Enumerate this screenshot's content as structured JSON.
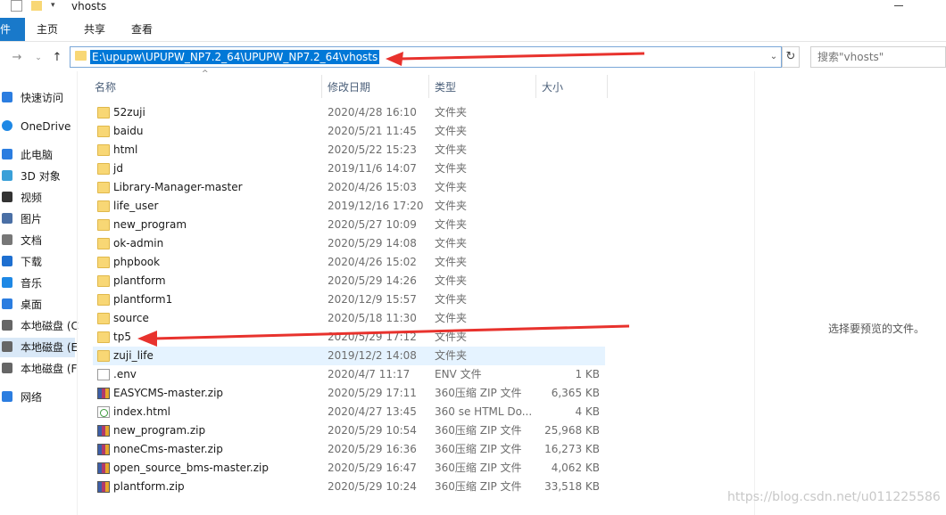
{
  "window": {
    "title": "vhosts",
    "minimize_icon": "minimize-icon"
  },
  "ribbon": {
    "file_tab": "件",
    "tabs": [
      "主页",
      "共享",
      "查看"
    ]
  },
  "address": {
    "path": "E:\\upupw\\UPUPW_NP7.2_64\\UPUPW_NP7.2_64\\vhosts",
    "search_placeholder": "搜索\"vhosts\""
  },
  "sidebar": {
    "items": [
      {
        "label": "快速访问",
        "icon": "star-icon"
      },
      {
        "label": "OneDrive",
        "icon": "cloud-icon"
      },
      {
        "label": "此电脑",
        "icon": "computer-icon"
      },
      {
        "label": "3D 对象",
        "icon": "cube-icon"
      },
      {
        "label": "视频",
        "icon": "video-icon"
      },
      {
        "label": "图片",
        "icon": "picture-icon"
      },
      {
        "label": "文档",
        "icon": "document-icon"
      },
      {
        "label": "下载",
        "icon": "download-icon"
      },
      {
        "label": "音乐",
        "icon": "music-icon"
      },
      {
        "label": "桌面",
        "icon": "desktop-icon"
      },
      {
        "label": "本地磁盘 (C",
        "icon": "drive-icon"
      },
      {
        "label": "本地磁盘 (E",
        "icon": "drive-icon"
      },
      {
        "label": "本地磁盘 (F",
        "icon": "drive-icon"
      },
      {
        "label": "网络",
        "icon": "network-icon"
      }
    ]
  },
  "columns": {
    "name": "名称",
    "date": "修改日期",
    "type": "类型",
    "size": "大小"
  },
  "files": [
    {
      "name": "52zuji",
      "date": "2020/4/28 16:10",
      "type": "文件夹",
      "size": "",
      "kind": "folder"
    },
    {
      "name": "baidu",
      "date": "2020/5/21 11:45",
      "type": "文件夹",
      "size": "",
      "kind": "folder"
    },
    {
      "name": "html",
      "date": "2020/5/22 15:23",
      "type": "文件夹",
      "size": "",
      "kind": "folder"
    },
    {
      "name": "jd",
      "date": "2019/11/6 14:07",
      "type": "文件夹",
      "size": "",
      "kind": "folder"
    },
    {
      "name": "Library-Manager-master",
      "date": "2020/4/26 15:03",
      "type": "文件夹",
      "size": "",
      "kind": "folder"
    },
    {
      "name": "life_user",
      "date": "2019/12/16 17:20",
      "type": "文件夹",
      "size": "",
      "kind": "folder"
    },
    {
      "name": "new_program",
      "date": "2020/5/27 10:09",
      "type": "文件夹",
      "size": "",
      "kind": "folder"
    },
    {
      "name": "ok-admin",
      "date": "2020/5/29 14:08",
      "type": "文件夹",
      "size": "",
      "kind": "folder"
    },
    {
      "name": "phpbook",
      "date": "2020/4/26 15:02",
      "type": "文件夹",
      "size": "",
      "kind": "folder"
    },
    {
      "name": "plantform",
      "date": "2020/5/29 14:26",
      "type": "文件夹",
      "size": "",
      "kind": "folder"
    },
    {
      "name": "plantform1",
      "date": "2020/12/9 15:57",
      "type": "文件夹",
      "size": "",
      "kind": "folder"
    },
    {
      "name": "source",
      "date": "2020/5/18 11:30",
      "type": "文件夹",
      "size": "",
      "kind": "folder"
    },
    {
      "name": "tp5",
      "date": "2020/5/29 17:12",
      "type": "文件夹",
      "size": "",
      "kind": "folder"
    },
    {
      "name": "zuji_life",
      "date": "2019/12/2 14:08",
      "type": "文件夹",
      "size": "",
      "kind": "folder"
    },
    {
      "name": ".env",
      "date": "2020/4/7 11:17",
      "type": "ENV 文件",
      "size": "1 KB",
      "kind": "file"
    },
    {
      "name": "EASYCMS-master.zip",
      "date": "2020/5/29 17:11",
      "type": "360压缩 ZIP 文件",
      "size": "6,365 KB",
      "kind": "zip"
    },
    {
      "name": "index.html",
      "date": "2020/4/27 13:45",
      "type": "360 se HTML Do...",
      "size": "4 KB",
      "kind": "html"
    },
    {
      "name": "new_program.zip",
      "date": "2020/5/29 10:54",
      "type": "360压缩 ZIP 文件",
      "size": "25,968 KB",
      "kind": "zip"
    },
    {
      "name": "noneCms-master.zip",
      "date": "2020/5/29 16:36",
      "type": "360压缩 ZIP 文件",
      "size": "16,273 KB",
      "kind": "zip"
    },
    {
      "name": "open_source_bms-master.zip",
      "date": "2020/5/29 16:47",
      "type": "360压缩 ZIP 文件",
      "size": "4,062 KB",
      "kind": "zip"
    },
    {
      "name": "plantform.zip",
      "date": "2020/5/29 10:24",
      "type": "360压缩 ZIP 文件",
      "size": "33,518 KB",
      "kind": "zip"
    }
  ],
  "preview": {
    "empty_text": "选择要预览的文件。"
  },
  "watermark": "https://blog.csdn.net/u011225586",
  "colors": {
    "accent": "#0078d7",
    "annotation_arrow": "#e8322d",
    "hover_row": "#e5f3ff",
    "folder": "#f8d775"
  }
}
